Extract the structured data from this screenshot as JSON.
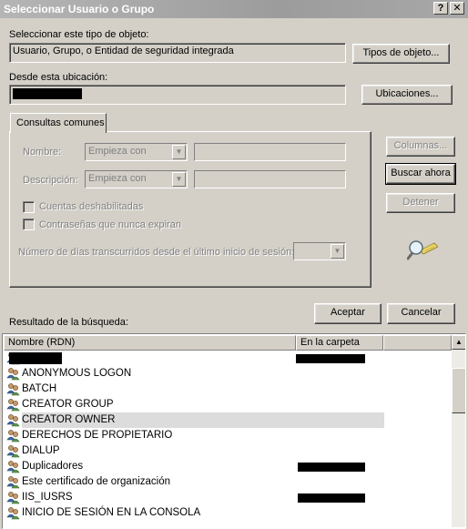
{
  "window": {
    "title": "Seleccionar Usuario o Grupo",
    "help_glyph": "?",
    "close_glyph": "✕"
  },
  "object_type": {
    "label": "Seleccionar este tipo de objeto:",
    "value": "Usuario, Grupo, o Entidad de seguridad integrada",
    "button": "Tipos de objeto..."
  },
  "location": {
    "label": "Desde esta ubicación:",
    "value": "",
    "button": "Ubicaciones..."
  },
  "tab": {
    "label": "Consultas comunes"
  },
  "query": {
    "name_label": "Nombre:",
    "name_op": "Empieza con",
    "desc_label": "Descripción:",
    "desc_op": "Empieza con",
    "disabled_accounts": "Cuentas deshabilitadas",
    "non_expiring": "Contraseñas que nunca expiran",
    "days_label": "Número de días transcurridos desde el último inicio de sesión:"
  },
  "side_buttons": {
    "columns": "Columnas...",
    "search_now": "Buscar ahora",
    "stop": "Detener"
  },
  "dialog_buttons": {
    "ok": "Aceptar",
    "cancel": "Cancelar"
  },
  "results": {
    "label": "Resultado de la búsqueda:",
    "columns": [
      "Nombre (RDN)",
      "En la carpeta"
    ],
    "rows": [
      {
        "name": ""
      },
      {
        "name": "ANONYMOUS LOGON"
      },
      {
        "name": "BATCH"
      },
      {
        "name": "CREATOR GROUP"
      },
      {
        "name": "CREATOR OWNER"
      },
      {
        "name": "DERECHOS DE PROPIETARIO"
      },
      {
        "name": "DIALUP"
      },
      {
        "name": "Duplicadores"
      },
      {
        "name": "Este certificado de organización"
      },
      {
        "name": "IIS_IUSRS"
      },
      {
        "name": "INICIO DE SESIÓN EN LA CONSOLA"
      }
    ]
  },
  "icons": {
    "user_group": "user-group-icon",
    "search_glass": "magnifier-icon",
    "combo_arrow": "▼",
    "scroll_up": "▲"
  }
}
